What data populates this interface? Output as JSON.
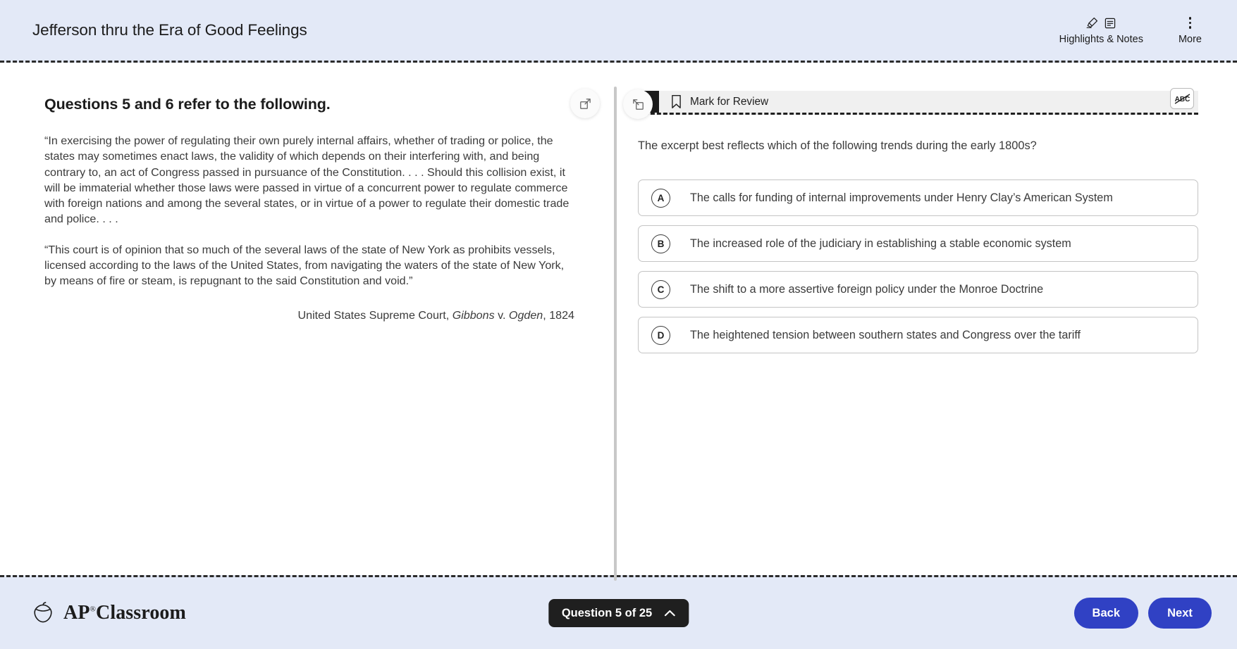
{
  "header": {
    "title": "Jefferson thru the Era of Good Feelings",
    "highlights_label": "Highlights & Notes",
    "more_label": "More",
    "highlighter_icon": "highlighter-icon",
    "note_icon": "note-icon",
    "more_icon": "kebab-menu-icon"
  },
  "toolbar": {
    "expand_left_icon": "expand-panel-icon",
    "collapse_right_icon": "collapse-panel-icon"
  },
  "passage": {
    "heading": "Questions 5 and 6 refer to the following.",
    "paragraphs": [
      "“In exercising the power of regulating their own purely internal affairs, whether of trading or police, the states may sometimes enact laws, the validity of which depends on their interfering with, and being contrary to, an act of Congress passed in pursuance of the Constitution. . . . Should this collision exist, it will be immaterial whether those laws were passed in virtue of a concurrent power to regulate commerce with foreign nations and among the several states, or in virtue of a power to regulate their domestic trade and police. . . .",
      "“This court is of opinion that so much of the several laws of the state of New York as prohibits vessels, licensed according to the laws of the United States, from navigating the waters of the state of New York, by means of fire or steam, is repugnant to the said Constitution and void.”"
    ],
    "citation": {
      "prefix": "United States Supreme Court, ",
      "case_italic_1": "Gibbons",
      "middle": " v. ",
      "case_italic_2": "Ogden",
      "suffix": ", 1824"
    }
  },
  "question": {
    "number": "5",
    "mark_for_review_label": "Mark for Review",
    "bookmark_icon": "bookmark-icon",
    "crossout_icon": "abc-crossout-icon",
    "stem": "The excerpt best reflects which of the following trends during the early 1800s?",
    "options": [
      {
        "letter": "A",
        "text": "The calls for funding of internal improvements under Henry Clay’s American System"
      },
      {
        "letter": "B",
        "text": "The increased role of the judiciary in establishing a stable economic system"
      },
      {
        "letter": "C",
        "text": "The shift to a more assertive foreign policy under the Monroe Doctrine"
      },
      {
        "letter": "D",
        "text": "The heightened tension between southern states and Congress over the tariff"
      }
    ]
  },
  "footer": {
    "brand_ap": "AP",
    "brand_reg": "®",
    "brand_classroom": "Classroom",
    "acorn_icon": "acorn-logo-icon",
    "pager_label": "Question 5 of 25",
    "pager_chevron_icon": "chevron-up-icon",
    "back_label": "Back",
    "next_label": "Next"
  },
  "colors": {
    "header_bg": "#e3e9f7",
    "accent_blue": "#3041c4",
    "dark": "#1f1f1f",
    "qbar_bg": "#f0f0f0"
  }
}
